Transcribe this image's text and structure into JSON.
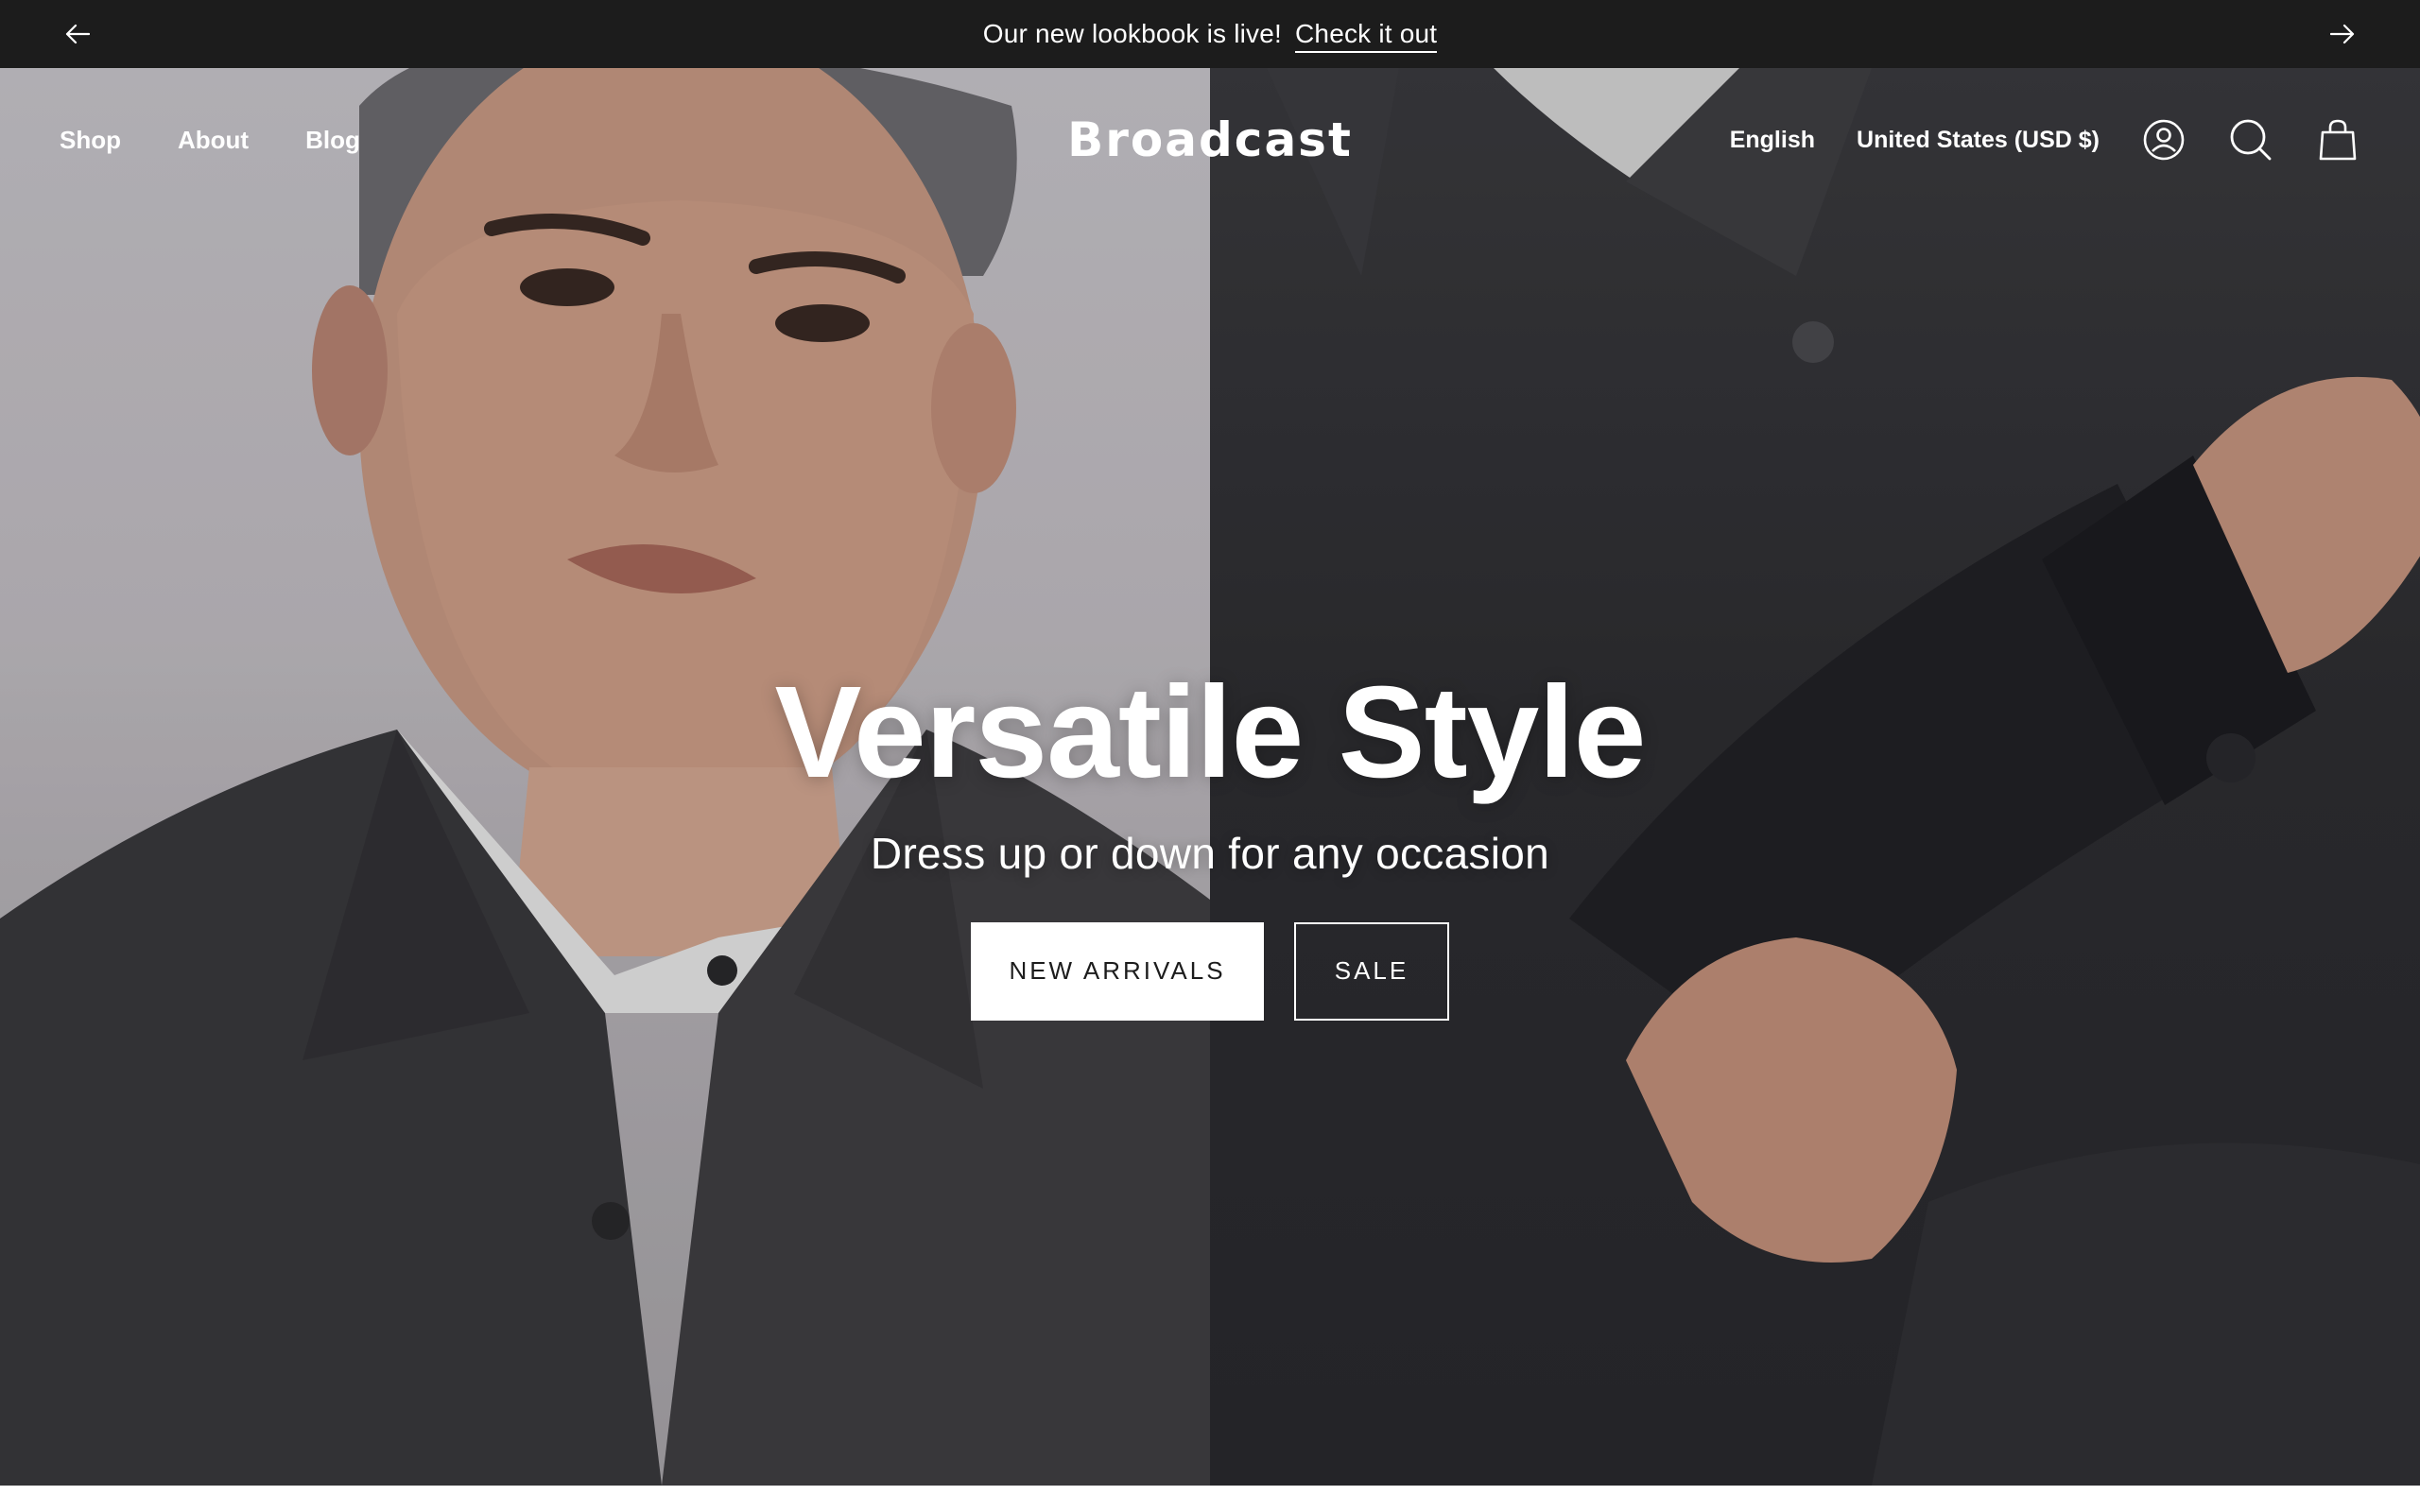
{
  "announcement": {
    "text": "Our new lookbook is live!",
    "link_text": "Check it out",
    "prev_icon": "arrow-left-icon",
    "next_icon": "arrow-right-icon"
  },
  "header": {
    "logo": "Broadcast",
    "nav_left": [
      {
        "label": "Shop"
      },
      {
        "label": "About"
      },
      {
        "label": "Blog"
      }
    ],
    "language": "English",
    "currency": "United States (USD $)",
    "icons": [
      "account-icon",
      "search-icon",
      "cart-icon"
    ]
  },
  "hero": {
    "title": "Versatile Style",
    "subtitle": "Dress up or down for any occasion",
    "buttons": {
      "primary": "NEW ARRIVALS",
      "secondary": "SALE"
    }
  },
  "colors": {
    "announcement_bg": "#1c1c1c",
    "text_light": "#ffffff",
    "button_text_dark": "#1c1c1c"
  }
}
